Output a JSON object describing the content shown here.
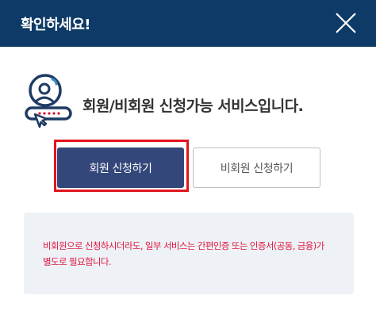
{
  "dialog": {
    "title": "확인하세요!",
    "close_icon": "close-icon"
  },
  "info": {
    "icon": "user-login-icon",
    "message": "회원/비회원 신청가능 서비스입니다."
  },
  "buttons": {
    "member": "회원 신청하기",
    "nonmember": "비회원 신청하기"
  },
  "notice": {
    "text": "비회원으로 신청하시더라도, 일부 서비스는 간편인증 또는 인증서(공동, 금융)가 별도로 필요합니다."
  },
  "colors": {
    "header": "#0d3a66",
    "primary_button": "#34477a",
    "highlight": "#e2141d",
    "notice_text": "#e0173f",
    "notice_bg": "#eef2f7"
  }
}
